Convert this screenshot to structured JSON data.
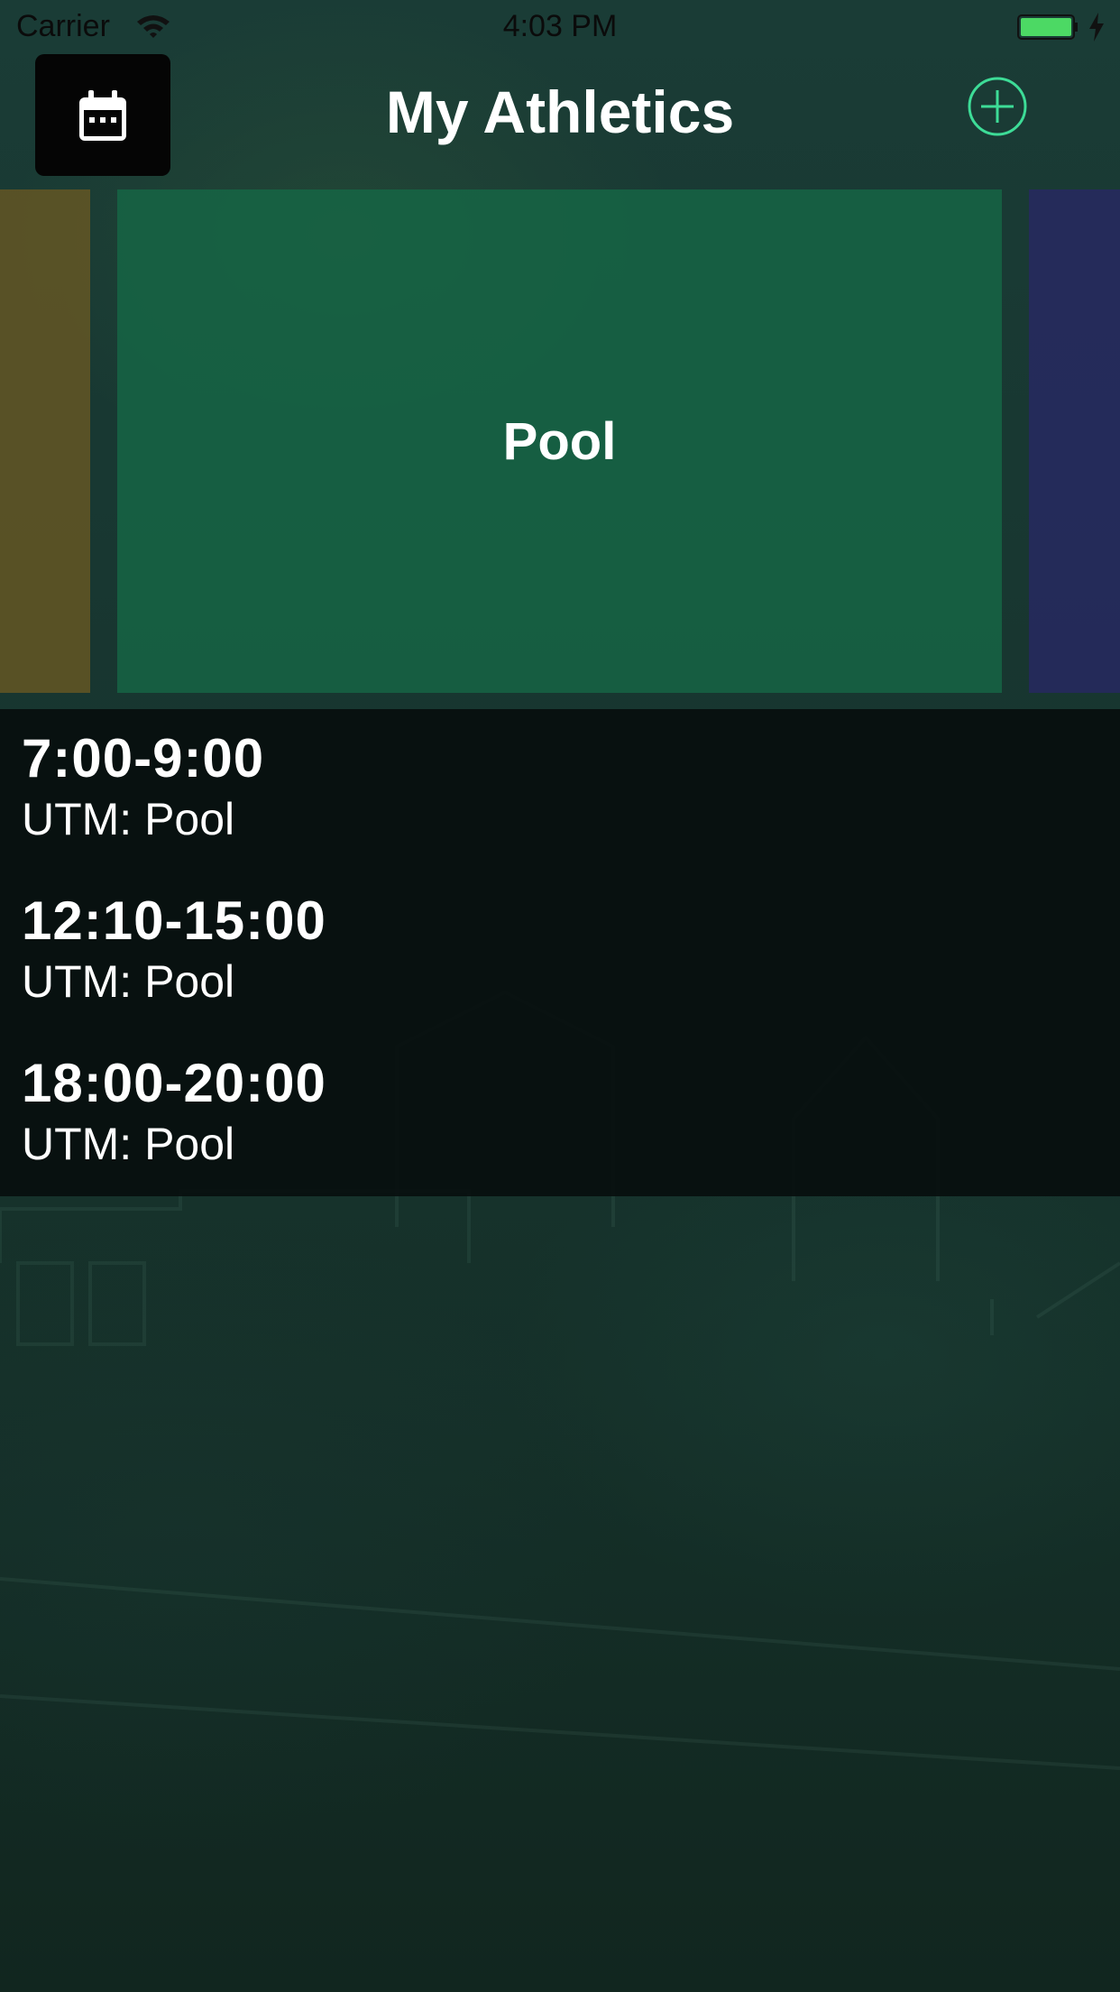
{
  "status_bar": {
    "carrier": "Carrier",
    "time": "4:03 PM",
    "battery_color": "#4cd964"
  },
  "nav": {
    "title": "My Athletics",
    "calendar_icon": "calendar-icon",
    "add_icon": "plus-circle-icon",
    "accent_color": "#3ddc97"
  },
  "carousel": {
    "current": "Pool",
    "prev_color": "#6a5822",
    "current_color": "#166646",
    "next_color": "#282864"
  },
  "schedule": [
    {
      "time": "7:00-9:00",
      "location": "UTM: Pool"
    },
    {
      "time": "12:10-15:00",
      "location": "UTM: Pool"
    },
    {
      "time": "18:00-20:00",
      "location": "UTM: Pool"
    }
  ]
}
